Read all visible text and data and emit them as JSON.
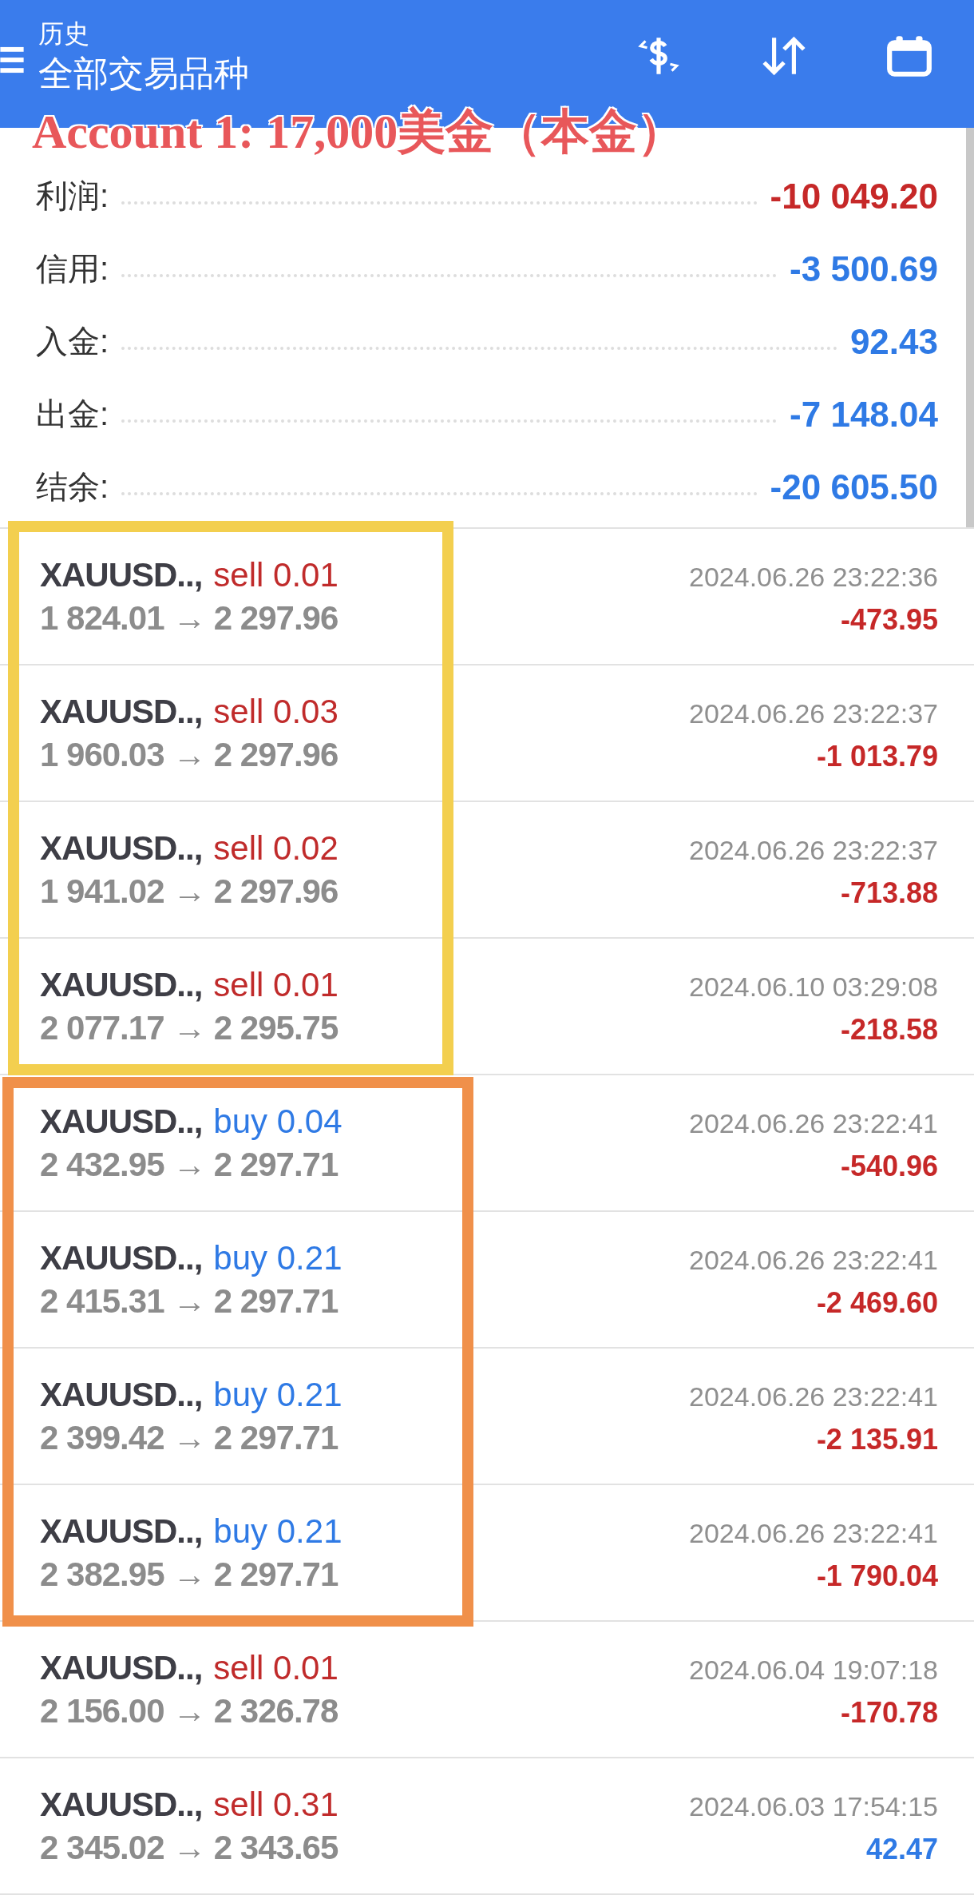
{
  "header": {
    "title": "历史",
    "subtitle": "全部交易品种"
  },
  "overlay_caption": "Account 1: 17,000美金（本金）",
  "summary": [
    {
      "label": "利润:",
      "value": "-10 049.20",
      "color": "#c62828"
    },
    {
      "label": "信用:",
      "value": "-3 500.69",
      "color": "#2f7ae5"
    },
    {
      "label": "入金:",
      "value": "92.43",
      "color": "#2f7ae5"
    },
    {
      "label": "出金:",
      "value": "-7 148.04",
      "color": "#2f7ae5"
    },
    {
      "label": "结余:",
      "value": "-20 605.50",
      "color": "#2f7ae5"
    }
  ],
  "trade_groups": [
    {
      "color": "#f3cf4f",
      "trades": [
        {
          "symbol": "XAUUSD..,",
          "order": {
            "kind": "sell",
            "text": "sell 0.01"
          },
          "prices": "1 824.01 → 2 297.96",
          "time": "2024.06.26 23:22:36",
          "profit": {
            "kind": "loss",
            "text": "-473.95"
          }
        },
        {
          "symbol": "XAUUSD..,",
          "order": {
            "kind": "sell",
            "text": "sell 0.03"
          },
          "prices": "1 960.03 → 2 297.96",
          "time": "2024.06.26 23:22:37",
          "profit": {
            "kind": "loss",
            "text": "-1 013.79"
          }
        },
        {
          "symbol": "XAUUSD..,",
          "order": {
            "kind": "sell",
            "text": "sell 0.02"
          },
          "prices": "1 941.02 → 2 297.96",
          "time": "2024.06.26 23:22:37",
          "profit": {
            "kind": "loss",
            "text": "-713.88"
          }
        },
        {
          "symbol": "XAUUSD..,",
          "order": {
            "kind": "sell",
            "text": "sell 0.01"
          },
          "prices": "2 077.17 → 2 295.75",
          "time": "2024.06.10 03:29:08",
          "profit": {
            "kind": "loss",
            "text": "-218.58"
          }
        }
      ]
    },
    {
      "color": "#f0904a",
      "trades": [
        {
          "symbol": "XAUUSD..,",
          "order": {
            "kind": "buy",
            "text": "buy 0.04"
          },
          "prices": "2 432.95 → 2 297.71",
          "time": "2024.06.26 23:22:41",
          "profit": {
            "kind": "loss",
            "text": "-540.96"
          }
        },
        {
          "symbol": "XAUUSD..,",
          "order": {
            "kind": "buy",
            "text": "buy 0.21"
          },
          "prices": "2 415.31 → 2 297.71",
          "time": "2024.06.26 23:22:41",
          "profit": {
            "kind": "loss",
            "text": "-2 469.60"
          }
        },
        {
          "symbol": "XAUUSD..,",
          "order": {
            "kind": "buy",
            "text": "buy 0.21"
          },
          "prices": "2 399.42 → 2 297.71",
          "time": "2024.06.26 23:22:41",
          "profit": {
            "kind": "loss",
            "text": "-2 135.91"
          }
        },
        {
          "symbol": "XAUUSD..,",
          "order": {
            "kind": "buy",
            "text": "buy 0.21"
          },
          "prices": "2 382.95 → 2 297.71",
          "time": "2024.06.26 23:22:41",
          "profit": {
            "kind": "loss",
            "text": "-1 790.04"
          }
        }
      ]
    },
    {
      "trades": [
        {
          "symbol": "XAUUSD..,",
          "order": {
            "kind": "sell",
            "text": "sell 0.01"
          },
          "prices": "2 156.00 → 2 326.78",
          "time": "2024.06.04 19:07:18",
          "profit": {
            "kind": "loss",
            "text": "-170.78"
          }
        },
        {
          "symbol": "XAUUSD..,",
          "order": {
            "kind": "sell",
            "text": "sell 0.31"
          },
          "prices": "2 345.02 → 2 343.65",
          "time": "2024.06.03 17:54:15",
          "profit": {
            "kind": "gain",
            "text": "42.47"
          }
        }
      ]
    }
  ]
}
